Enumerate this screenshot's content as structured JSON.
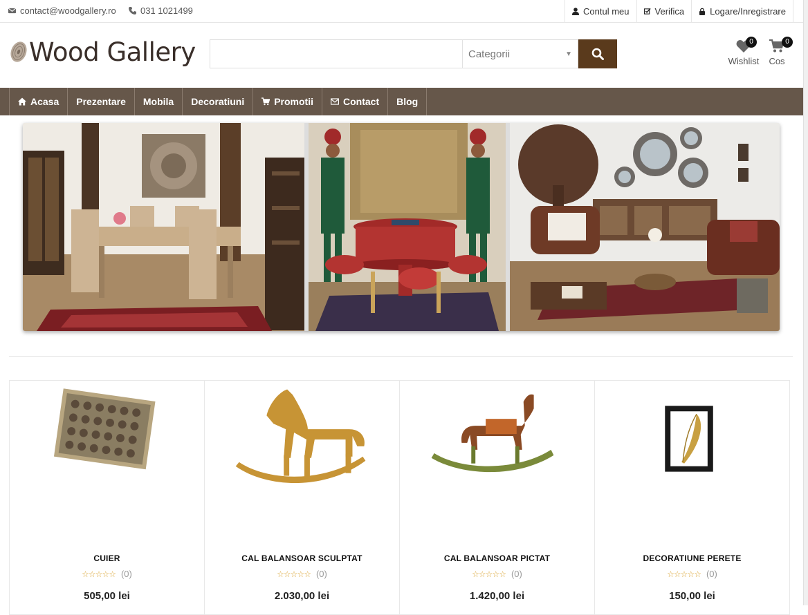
{
  "topbar": {
    "email": "contact@woodgallery.ro",
    "phone": "031 1021499",
    "links": [
      "Contul meu",
      "Verifica",
      "Logare/Inregistrare"
    ]
  },
  "header": {
    "logo_text": "Wood Gallery",
    "search_placeholder": "",
    "category_select": "Categorii",
    "wishlist_label": "Wishlist",
    "wishlist_count": "0",
    "cart_label": "Cos",
    "cart_count": "0"
  },
  "nav": {
    "items": [
      {
        "label": "Acasa",
        "icon": "home-icon"
      },
      {
        "label": "Prezentare",
        "icon": ""
      },
      {
        "label": "Mobila",
        "icon": ""
      },
      {
        "label": "Decoratiuni",
        "icon": ""
      },
      {
        "label": "Promotii",
        "icon": "cart-icon"
      },
      {
        "label": "Contact",
        "icon": "envelope-icon"
      },
      {
        "label": "Blog",
        "icon": ""
      }
    ]
  },
  "products": [
    {
      "name": "CUIER",
      "rating_count": "(0)",
      "price": "505,00 lei"
    },
    {
      "name": "CAL BALANSOAR SCULPTAT",
      "rating_count": "(0)",
      "price": "2.030,00 lei"
    },
    {
      "name": "CAL BALANSOAR PICTAT",
      "rating_count": "(0)",
      "price": "1.420,00 lei"
    },
    {
      "name": "DECORATIUNE PERETE",
      "rating_count": "(0)",
      "price": "150,00 lei"
    }
  ],
  "colors": {
    "nav_bg": "#66574a",
    "search_button": "#5a3a1c",
    "star": "#d9a02a"
  }
}
